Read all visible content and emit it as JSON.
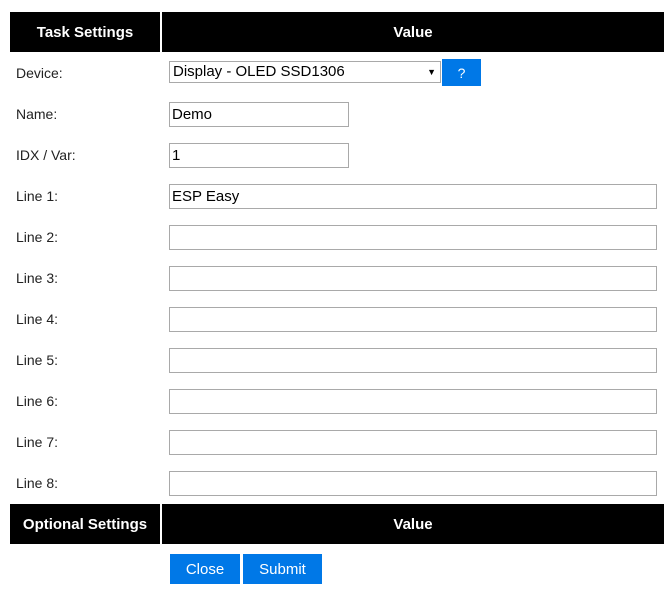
{
  "task_table": {
    "header_left": "Task Settings",
    "header_right": "Value"
  },
  "device": {
    "label": "Device:",
    "selected": "Display - OLED SSD1306",
    "help_label": "?"
  },
  "fields": [
    {
      "label": "Name:",
      "value": "Demo"
    },
    {
      "label": "IDX / Var:",
      "value": "1"
    },
    {
      "label": "Line 1:",
      "value": "ESP Easy"
    },
    {
      "label": "Line 2:",
      "value": ""
    },
    {
      "label": "Line 3:",
      "value": ""
    },
    {
      "label": "Line 4:",
      "value": ""
    },
    {
      "label": "Line 5:",
      "value": ""
    },
    {
      "label": "Line 6:",
      "value": ""
    },
    {
      "label": "Line 7:",
      "value": ""
    },
    {
      "label": "Line 8:",
      "value": ""
    }
  ],
  "optional_table": {
    "header_left": "Optional Settings",
    "header_right": "Value"
  },
  "actions": {
    "close_label": "Close",
    "submit_label": "Submit"
  },
  "colors": {
    "header_bg": "#000000",
    "header_text": "#ffffff",
    "button_bg": "#0078e7",
    "button_text": "#ffffff"
  }
}
